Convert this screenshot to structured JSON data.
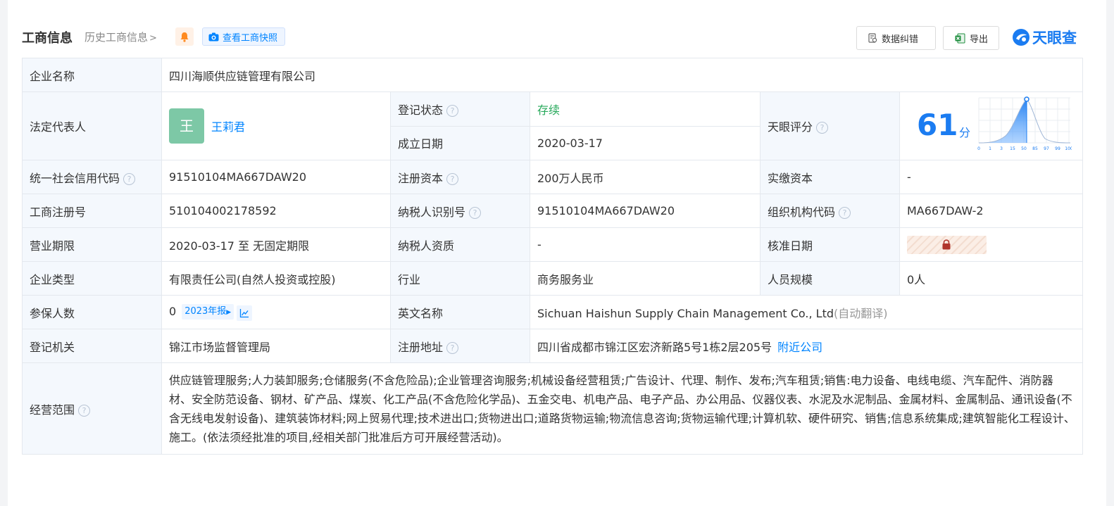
{
  "header": {
    "title": "工商信息",
    "history_link": "历史工商信息",
    "snapshot_button": "查看工商快照",
    "data_fix_button": "数据纠错",
    "export_button": "导出",
    "logo_text": "天眼查"
  },
  "company": {
    "name_label": "企业名称",
    "name": "四川海顺供应链管理有限公司",
    "legal_rep_label": "法定代表人",
    "legal_rep_avatar": "王",
    "legal_rep_name": "王莉君",
    "reg_status_label": "登记状态",
    "reg_status": "存续",
    "found_date_label": "成立日期",
    "found_date": "2020-03-17",
    "score_label": "天眼评分",
    "score": "61",
    "score_unit": "分",
    "score_axis": [
      "0",
      "1",
      "3",
      "15",
      "50",
      "85",
      "97",
      "99",
      "100"
    ],
    "credit_code_label": "统一社会信用代码",
    "credit_code": "91510104MA667DAW20",
    "reg_capital_label": "注册资本",
    "reg_capital": "200万人民币",
    "paid_capital_label": "实缴资本",
    "paid_capital": "-",
    "reg_no_label": "工商注册号",
    "reg_no": "510104002178592",
    "taxpayer_id_label": "纳税人识别号",
    "taxpayer_id": "91510104MA667DAW20",
    "org_code_label": "组织机构代码",
    "org_code": "MA667DAW-2",
    "biz_term_label": "营业期限",
    "biz_term": "2020-03-17 至 无固定期限",
    "taxpayer_qual_label": "纳税人资质",
    "taxpayer_qual": "-",
    "approve_date_label": "核准日期",
    "company_type_label": "企业类型",
    "company_type": "有限责任公司(自然人投资或控股)",
    "industry_label": "行业",
    "industry": "商务服务业",
    "staff_size_label": "人员规模",
    "staff_size": "0人",
    "insured_label": "参保人数",
    "insured": "0",
    "insured_report": "2023年报",
    "en_name_label": "英文名称",
    "en_name": "Sichuan Haishun Supply Chain Management Co., Ltd",
    "en_name_note": "(自动翻译)",
    "reg_authority_label": "登记机关",
    "reg_authority": "锦江市场监督管理局",
    "reg_address_label": "注册地址",
    "reg_address": "四川省成都市锦江区宏济新路5号1栋2层205号",
    "nearby_link": "附近公司",
    "scope_label": "经营范围",
    "scope": "供应链管理服务;人力装卸服务;仓储服务(不含危险品);企业管理咨询服务;机械设备经营租赁;广告设计、代理、制作、发布;汽车租赁;销售:电力设备、电线电缆、汽车配件、消防器材、安全防范设备、钢材、矿产品、煤炭、化工产品(不含危险化学品)、五金交电、机电产品、电子产品、办公用品、仪器仪表、水泥及水泥制品、金属材料、金属制品、通讯设备(不含无线电发射设备)、建筑装饰材料;网上贸易代理;技术进出口;货物进出口;道路货物运输;物流信息咨询;货物运输代理;计算机软、硬件研究、销售;信息系统集成;建筑智能化工程设计、施工。(依法须经批准的项目,经相关部门批准后方可开展经营活动)。"
  }
}
